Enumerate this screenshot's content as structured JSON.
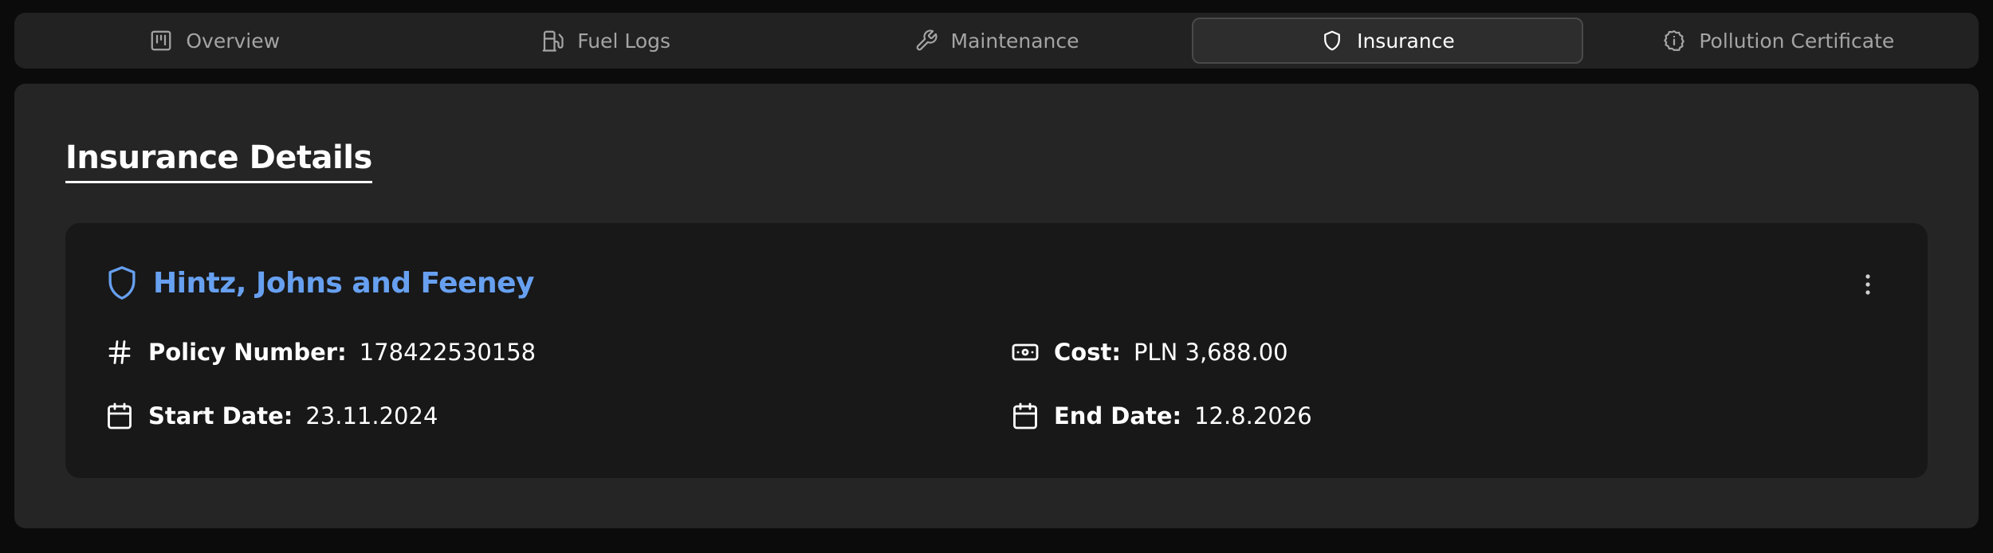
{
  "tabs": [
    {
      "label": "Overview",
      "icon": "overview-icon",
      "active": false
    },
    {
      "label": "Fuel Logs",
      "icon": "fuel-pump-icon",
      "active": false
    },
    {
      "label": "Maintenance",
      "icon": "wrench-icon",
      "active": false
    },
    {
      "label": "Insurance",
      "icon": "shield-icon",
      "active": true
    },
    {
      "label": "Pollution Certificate",
      "icon": "info-badge-icon",
      "active": false
    }
  ],
  "section": {
    "title": "Insurance Details"
  },
  "policy": {
    "provider": "Hintz, Johns and Feeney",
    "provider_icon": "shield-icon",
    "menu_icon": "more-vertical-icon",
    "policy_number_label": "Policy Number:",
    "policy_number": "178422530158",
    "cost_label": "Cost:",
    "cost": "PLN 3,688.00",
    "start_date_label": "Start Date:",
    "start_date": "23.11.2024",
    "end_date_label": "End Date:",
    "end_date": "12.8.2026"
  },
  "colors": {
    "accent": "#67a0f0",
    "background": "#0b0b0b",
    "panel": "#252525",
    "card": "#181818"
  }
}
